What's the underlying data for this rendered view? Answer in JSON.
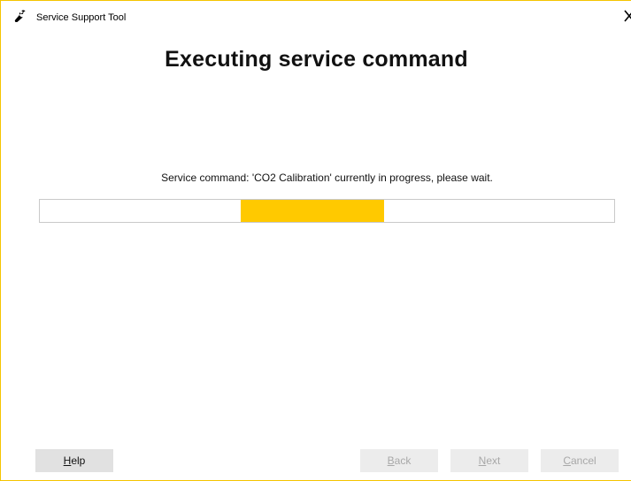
{
  "window": {
    "title": "Service Support Tool",
    "accent_color": "#f5c400",
    "icon": "wrench-icon",
    "close_icon": "close-icon"
  },
  "main": {
    "heading": "Executing service command",
    "message": "Service command: 'CO2 Calibration' currently in progress, please wait.",
    "progress": {
      "mode": "indeterminate",
      "chunk_start_fraction": 0.35,
      "chunk_end_fraction": 0.6,
      "color": "#ffc900"
    }
  },
  "buttons": {
    "help": {
      "mnemonic": "H",
      "rest": "elp",
      "enabled": true
    },
    "back": {
      "mnemonic": "B",
      "rest": "ack",
      "enabled": false
    },
    "next": {
      "mnemonic": "N",
      "rest": "ext",
      "enabled": false
    },
    "cancel": {
      "mnemonic": "C",
      "rest": "ancel",
      "enabled": false
    }
  }
}
